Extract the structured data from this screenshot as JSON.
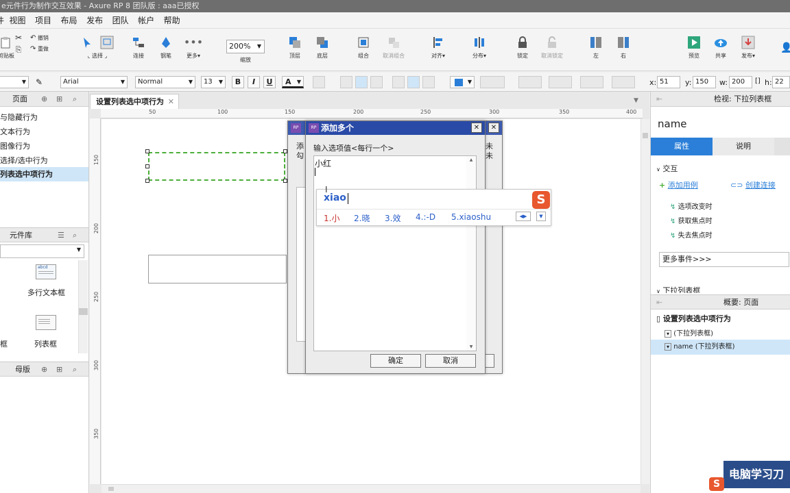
{
  "window": {
    "title": "e元件行为制作交互效果 - Axure RP 8 团队版 : aaa已授权"
  },
  "menu": [
    "视图",
    "项目",
    "布局",
    "发布",
    "团队",
    "帐户",
    "帮助"
  ],
  "menu_prefix": "件",
  "toolbar": {
    "clipboard_label": "剪贴板",
    "undo_label": "撤销",
    "redo_label": "重做",
    "select_label": "选择",
    "connect_label": "连接",
    "pen_label": "钢笔",
    "more_label": "更多▾",
    "zoom_value": "200%",
    "zoom_label": "缩放",
    "top_label": "顶层",
    "bottom_label": "底层",
    "group_label": "组合",
    "ungroup_label": "取消组合",
    "align_label": "对齐▾",
    "distribute_label": "分布▾",
    "lock_label": "锁定",
    "unlock_label": "取消锁定",
    "left_label": "左",
    "right_label": "右",
    "preview_label": "预览",
    "share_label": "共享",
    "publish_label": "发布▾"
  },
  "format": {
    "font": "Arial",
    "style": "Normal",
    "size": "13",
    "bold": "B",
    "italic": "I",
    "underline": "U",
    "font_color": "A",
    "x_label": "x:",
    "x": "51",
    "y_label": "y:",
    "y": "150",
    "w_label": "w:",
    "w": "200",
    "h_label": "h:",
    "h": "22"
  },
  "left": {
    "pages_title": "页面",
    "pages": [
      "与隐藏行为",
      "文本行为",
      "图像行为",
      "选择/选中行为",
      "列表选中项行为"
    ],
    "library_title": "元件库",
    "widgets": [
      "多行文本框",
      "框",
      "列表框"
    ],
    "masters_title": "母版"
  },
  "canvas": {
    "tab": "设置列表选中项行为",
    "hticks": [
      "50",
      "100",
      "150",
      "200",
      "250",
      "300",
      "350",
      "400"
    ],
    "vticks": [
      "150",
      "200",
      "250",
      "300",
      "350"
    ]
  },
  "dialog_back": {
    "text_left": "添\n勾",
    "text_right": "未\n未"
  },
  "dialog": {
    "title": "添加多个",
    "prompt": "输入选项值<每行一个>",
    "value": "小红",
    "ok": "确定",
    "cancel": "取消"
  },
  "ime": {
    "input": "xiao",
    "candidates": [
      "1.小",
      "2.晓",
      "3.效",
      "4.:-D",
      "5.xiaoshu"
    ]
  },
  "right": {
    "inspector_title": "检视: 下拉列表框",
    "widget_name": "name",
    "tab_properties": "属性",
    "tab_notes": "说明",
    "interaction": "交互",
    "add_case": "添加用例",
    "create_link": "创建连接",
    "events": [
      "选项改变时",
      "获取焦点时",
      "失去焦点时"
    ],
    "more_events": "更多事件>>>",
    "dropdown_section": "下拉列表框",
    "outline_title": "概要: 页面",
    "outline_page": "设置列表选中项行为",
    "outline_items": [
      "(下拉列表框)",
      "name (下拉列表框)"
    ]
  },
  "watermark": "电脑学习刀",
  "colors": {
    "accent": "#2b7fd8",
    "selected": "#cfe6f8",
    "dialog_title": "#2a4aa7",
    "green": "#4cae3a"
  }
}
